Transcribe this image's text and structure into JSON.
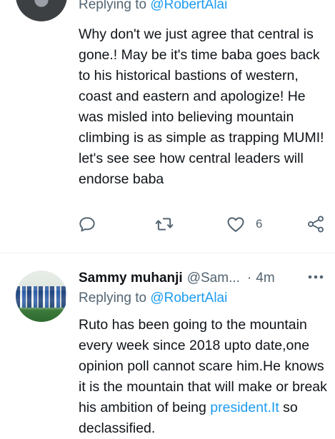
{
  "tweet1": {
    "replying_prefix": "Replying to",
    "replying_handle": "@RobertAlai",
    "text": "Why don't we just agree that central is gone.! May be it's time baba goes back to his historical bastions of western, coast and eastern and apologize! He was misled into believing mountain climbing is as simple as trapping MUMI! let's see see how central leaders will endorse baba",
    "actions": {
      "reply_icon": "reply-icon",
      "retweet_icon": "retweet-icon",
      "like_icon": "heart-icon",
      "like_count": "6",
      "share_icon": "share-icon"
    }
  },
  "tweet2": {
    "author_name": "Sammy muhanji",
    "author_handle": "@Sam...",
    "separator": "·",
    "time": "4m",
    "more_icon": "more-options-icon",
    "replying_prefix": "Replying to",
    "replying_handle": "@RobertAlai",
    "text_before_link": "Ruto has been going to the mountain every week since 2018 upto date,one opinion poll cannot scare him.He knows it is the mountain that will make or break  his ambition of being ",
    "link_text": "president.It",
    "text_after_link": " so declassified."
  },
  "colors": {
    "link": "#1d9bf0",
    "secondary_text": "#536471",
    "primary_text": "#0f1419",
    "divider": "#eff3f4"
  }
}
